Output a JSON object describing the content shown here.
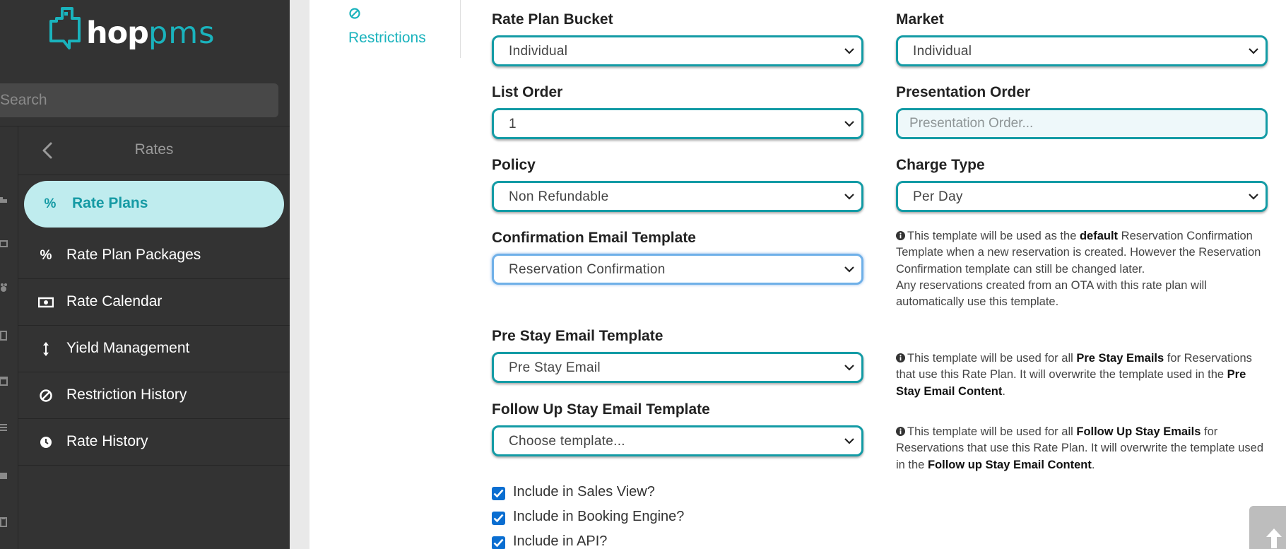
{
  "app": {
    "logo_text_primary": "hop",
    "logo_text_secondary": "pms"
  },
  "sidebar": {
    "search_placeholder": "Search",
    "section_title": "Rates",
    "items": [
      {
        "label": "Rate Plans",
        "icon": "percent-icon",
        "active": true
      },
      {
        "label": "Rate Plan Packages",
        "icon": "percent-icon",
        "active": false
      },
      {
        "label": "Rate Calendar",
        "icon": "money-bill-icon",
        "active": false
      },
      {
        "label": "Yield Management",
        "icon": "vertical-arrows-icon",
        "active": false
      },
      {
        "label": "Restriction History",
        "icon": "ban-icon",
        "active": false
      },
      {
        "label": "Rate History",
        "icon": "clock-icon",
        "active": false
      }
    ]
  },
  "tabs": {
    "restrictions_label": "Restrictions"
  },
  "form": {
    "rate_plan_bucket": {
      "label": "Rate Plan Bucket",
      "value": "Individual"
    },
    "market": {
      "label": "Market",
      "value": "Individual"
    },
    "list_order": {
      "label": "List Order",
      "value": "1"
    },
    "presentation_order": {
      "label": "Presentation Order",
      "placeholder": "Presentation Order..."
    },
    "policy": {
      "label": "Policy",
      "value": "Non Refundable"
    },
    "charge_type": {
      "label": "Charge Type",
      "value": "Per Day"
    },
    "confirmation_email": {
      "label": "Confirmation Email Template",
      "value": "Reservation Confirmation"
    },
    "pre_stay_email": {
      "label": "Pre Stay Email Template",
      "value": "Pre Stay Email"
    },
    "follow_up_email": {
      "label": "Follow Up Stay Email Template",
      "value": "Choose template..."
    }
  },
  "help": {
    "confirmation": {
      "t1": "This template will be used as the ",
      "b1": "default",
      "t2": " Reservation Confirmation Template when a new reservation is created. However the Reservation Confirmation template can still be changed later.",
      "t3": "Any reservations created from an OTA with this rate plan will automatically use this template."
    },
    "pre_stay": {
      "t1": "This template will be used for all ",
      "b1": "Pre Stay Emails",
      "t2": " for Reservations that use this Rate Plan. It will overwrite the template used in the ",
      "b2": "Pre Stay Email Content",
      "t3": "."
    },
    "follow_up": {
      "t1": "This template will be used for all ",
      "b1": "Follow Up Stay Emails",
      "t2": " for Reservations that use this Rate Plan. It will overwrite the template used in the ",
      "b2": "Follow up Stay Email Content",
      "t3": "."
    }
  },
  "checkboxes": [
    {
      "label": "Include in Sales View?",
      "checked": true
    },
    {
      "label": "Include in Booking Engine?",
      "checked": true
    },
    {
      "label": "Include in API?",
      "checked": true
    }
  ],
  "colors": {
    "accent": "#1ab3bd",
    "sidebar_bg": "#333333",
    "active_bg": "#bfecee",
    "checkbox": "#0a6ed1"
  }
}
